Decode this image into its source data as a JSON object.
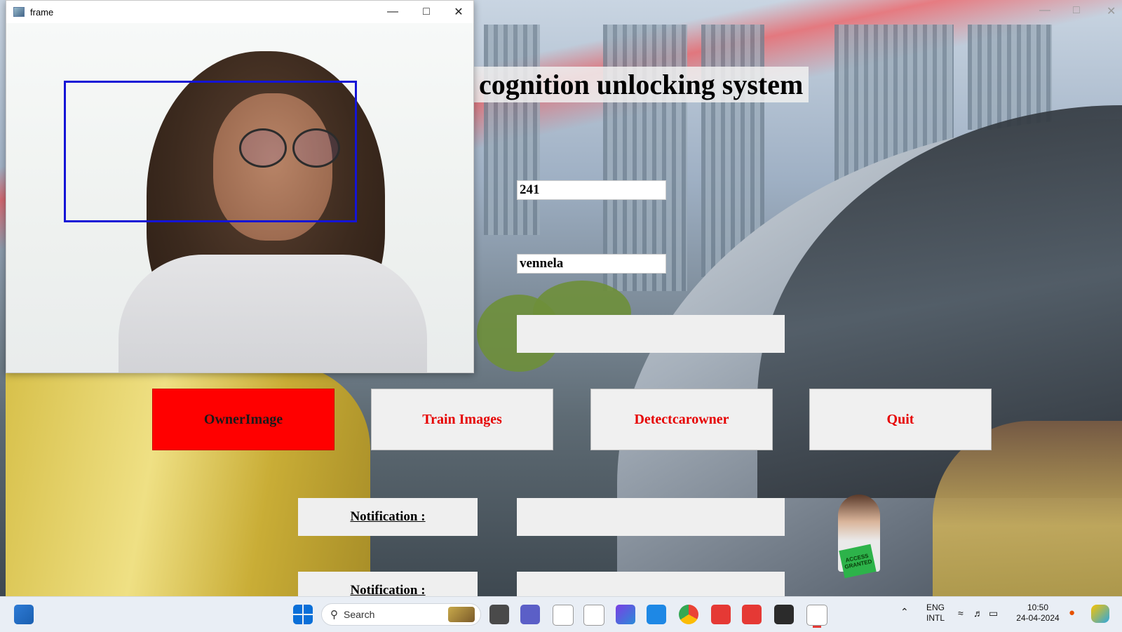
{
  "app": {
    "title": "cognition unlocking system",
    "fields": {
      "id_value": "241",
      "name_value": "vennela",
      "message_value": ""
    },
    "buttons": {
      "owner_image": "OwnerImage",
      "train_images": "Train Images",
      "detect_car_owner": "Detectcarowner",
      "quit": "Quit"
    },
    "notifications": [
      {
        "label": "Notification :",
        "value": ""
      },
      {
        "label": "Notification :",
        "value": ""
      }
    ],
    "badge_text": "ACCESS GRANTED"
  },
  "frame_window": {
    "title": "frame",
    "minimize_icon": "minimize-icon",
    "maximize_icon": "maximize-icon",
    "close_icon": "close-icon",
    "face_box_color": "#1414d6"
  },
  "taskbar": {
    "search_placeholder": "Search",
    "language_line1": "ENG",
    "language_line2": "INTL",
    "time": "10:50",
    "date": "24-04-2024"
  },
  "colors": {
    "button_text": "#e60000",
    "owner_button_bg": "#ff0000"
  }
}
